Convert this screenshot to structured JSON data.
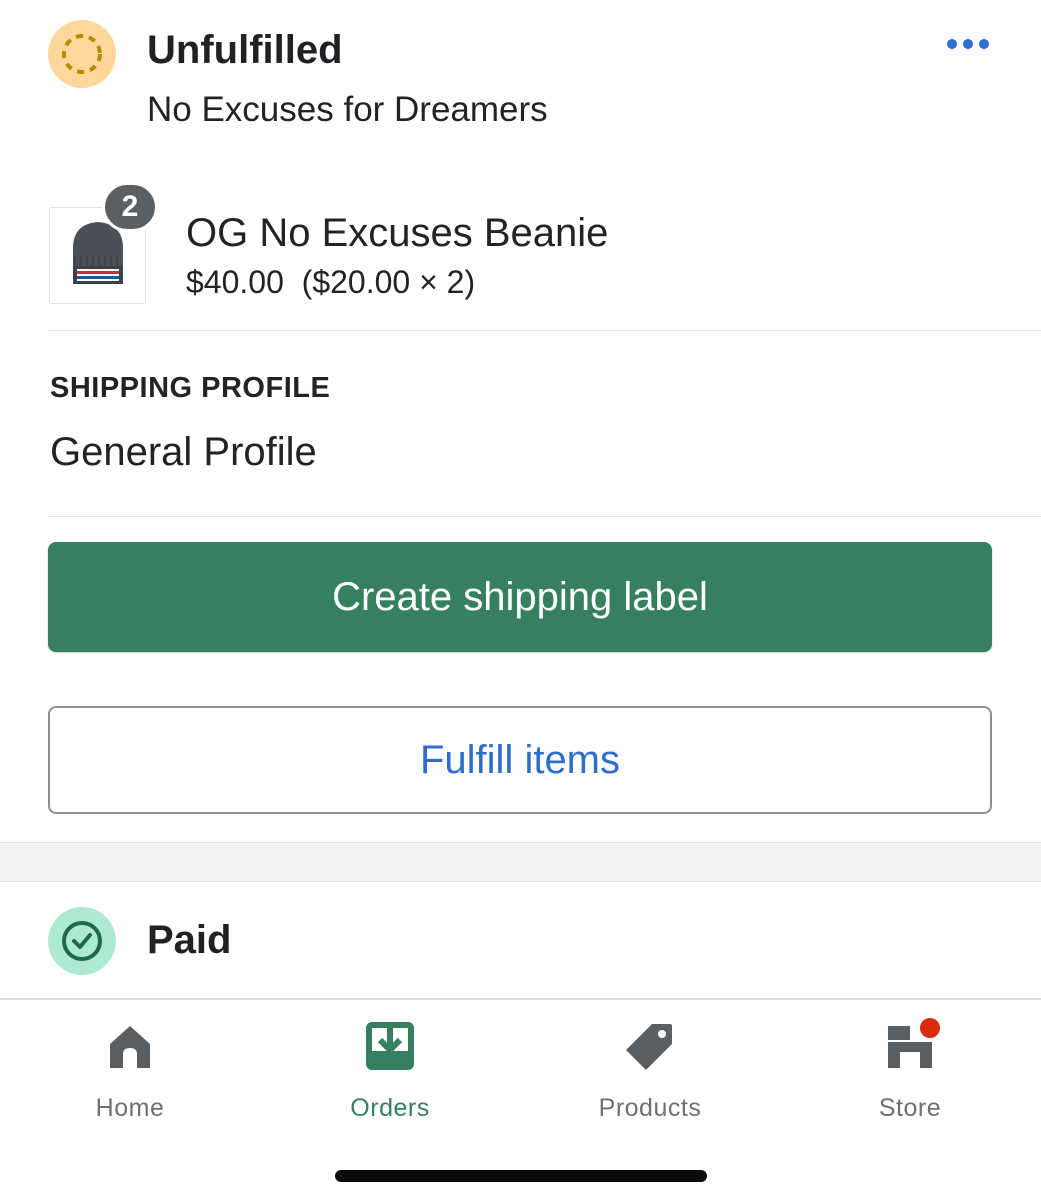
{
  "fulfillment": {
    "status": "Unfulfilled",
    "location": "No Excuses for Dreamers",
    "status_color": "#ffd79d"
  },
  "line_item": {
    "name": "OG No Excuses Beanie",
    "quantity": "2",
    "price": "$40.00  ($20.00 × 2)",
    "image_label": "EXCUSES"
  },
  "shipping": {
    "label": "SHIPPING PROFILE",
    "value": "General Profile"
  },
  "actions": {
    "primary": "Create shipping label",
    "secondary": "Fulfill items",
    "primary_color": "#368060",
    "secondary_text_color": "#2c6ecb"
  },
  "payment": {
    "status": "Paid",
    "status_color": "#aee9d1"
  },
  "tabbar": {
    "items": [
      {
        "label": "Home",
        "icon": "home-icon",
        "active": false
      },
      {
        "label": "Orders",
        "icon": "orders-icon",
        "active": true
      },
      {
        "label": "Products",
        "icon": "tag-icon",
        "active": false
      },
      {
        "label": "Store",
        "icon": "store-icon",
        "active": false,
        "notification": true
      }
    ]
  }
}
